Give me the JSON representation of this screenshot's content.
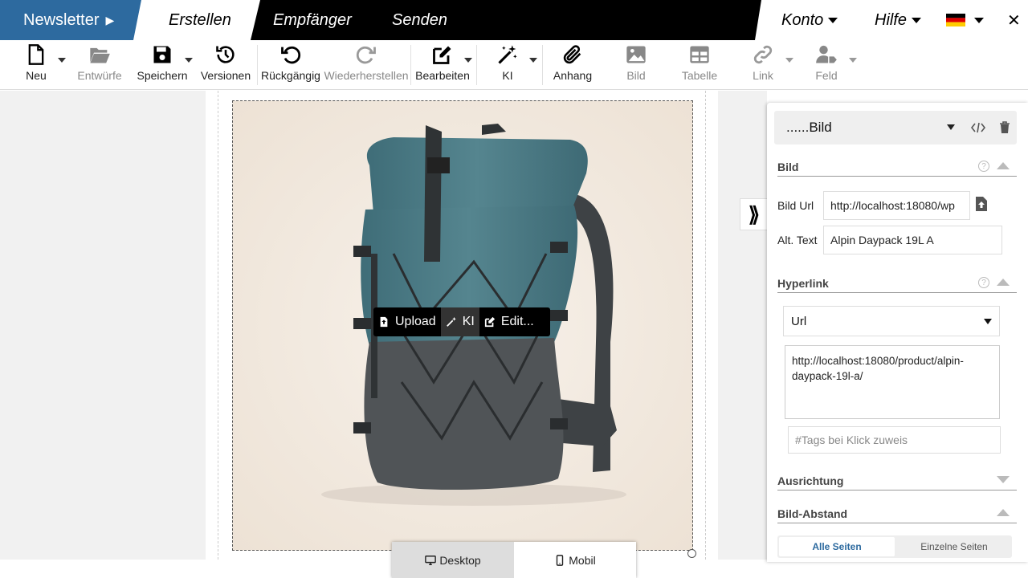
{
  "nav": {
    "brand": "Newsletter",
    "tabs": [
      "Erstellen",
      "Empfänger",
      "Senden"
    ],
    "account": "Konto",
    "help": "Hilfe",
    "close": "✕"
  },
  "toolbar": {
    "new": "Neu",
    "drafts": "Entwürfe",
    "save": "Speichern",
    "versions": "Versionen",
    "undo": "Rückgängig",
    "redo": "Wiederherstellen",
    "edit": "Bearbeiten",
    "ai": "KI",
    "attachment": "Anhang",
    "image": "Bild",
    "table": "Tabelle",
    "link": "Link",
    "field": "Feld"
  },
  "image_toolbar": {
    "upload": "Upload",
    "ai": "KI",
    "edit": "Edit..."
  },
  "device": {
    "desktop": "Desktop",
    "mobile": "Mobil"
  },
  "panel": {
    "title": "......Bild",
    "section_image": "Bild",
    "label_url": "Bild Url",
    "image_url": "http://localhost:18080/wp",
    "label_alt": "Alt. Text",
    "alt_text": "Alpin Daypack 19L A",
    "section_hyperlink": "Hyperlink",
    "link_type": "Url",
    "link_url": "http://localhost:18080/product/alpin-daypack-19l-a/",
    "tags_placeholder": "#Tags bei Klick zuweis",
    "section_alignment": "Ausrichtung",
    "section_spacing": "Bild-Abstand",
    "tab_all": "Alle Seiten",
    "tab_single": "Einzelne Seiten"
  },
  "colors": {
    "brand": "#2d6a9f",
    "backpack": "#4a7a86",
    "backpack_bottom": "#4d5053"
  }
}
